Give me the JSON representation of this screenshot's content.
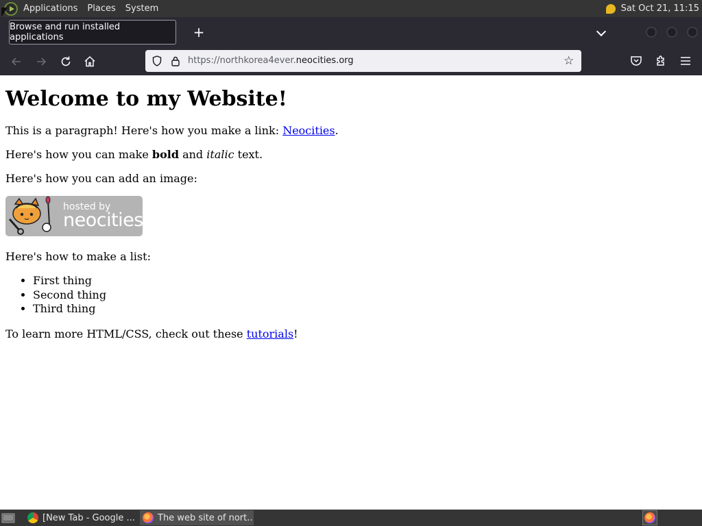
{
  "system_panel": {
    "menus": [
      "Applications",
      "Places",
      "System"
    ],
    "clock": "Sat Oct 21, 11:15"
  },
  "tooltip": "Browse and run installed applications",
  "browser": {
    "new_tab": "+",
    "url": {
      "prefix": "https://northkorea4ever.",
      "domain": "neocities.org"
    }
  },
  "page": {
    "heading": "Welcome to my Website!",
    "p1": {
      "text": "This is a paragraph! Here's how you make a link: ",
      "link": "Neocities",
      "end": "."
    },
    "p2": {
      "before": "Here's how you can make ",
      "bold": "bold",
      "middle": " and ",
      "italic": "italic",
      "end": " text."
    },
    "p3": "Here's how you can add an image:",
    "badge": {
      "hosted": "hosted by",
      "brand": "neocities"
    },
    "p4": "Here's how to make a list:",
    "list": [
      "First thing",
      "Second thing",
      "Third thing"
    ],
    "p5": {
      "text": "To learn more HTML/CSS, check out these ",
      "link": "tutorials",
      "end": "!"
    }
  },
  "taskbar": {
    "tasks": [
      "[New Tab - Google ...",
      "The web site of nort..."
    ]
  },
  "colors": {
    "link": "#0000ee",
    "browser_chrome": "#2b2a33",
    "panel": "#353535"
  }
}
